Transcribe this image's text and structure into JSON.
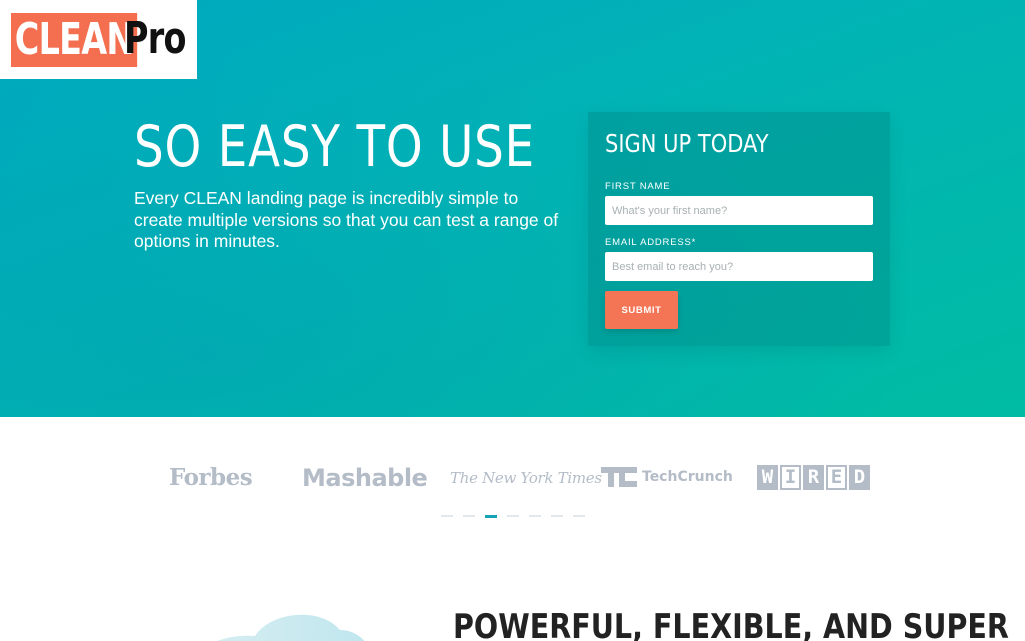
{
  "logo": {
    "part1": "CLEAN",
    "part2": "Pro"
  },
  "hero": {
    "headline": "SO EASY TO USE",
    "subtext": "Every CLEAN landing page is incredibly simple to create multiple versions so that you can test a range of options in minutes."
  },
  "form": {
    "title": "SIGN UP TODAY",
    "first_name_label": "FIRST NAME",
    "first_name_placeholder": "What's your first name?",
    "email_label": "EMAIL ADDRESS*",
    "email_placeholder": "Best email to reach you?",
    "submit_label": "SUBMIT"
  },
  "press": {
    "logos": [
      "Forbes",
      "Mashable",
      "The New York Times",
      "TechCrunch",
      "WIRED"
    ],
    "carousel_dots": 7,
    "active_dot": 2
  },
  "feature": {
    "title": "POWERFUL, FLEXIBLE, AND SUPER"
  },
  "colors": {
    "accent": "#f36f50",
    "hero_start": "#00a8c0",
    "hero_end": "#01bca3",
    "press_logo": "#b3bcc7",
    "active_dot": "#16a3b8"
  }
}
